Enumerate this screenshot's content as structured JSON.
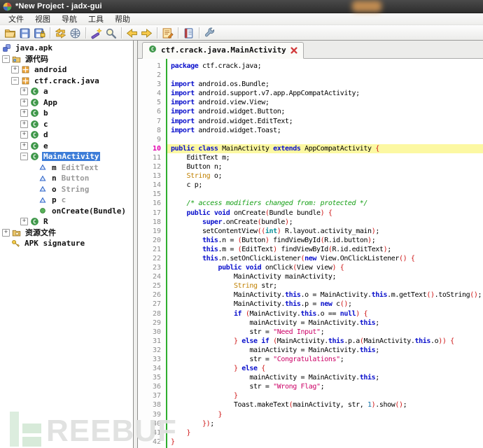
{
  "window": {
    "title": "*New Project - jadx-gui",
    "app_icon": "jadx-logo-icon"
  },
  "menubar": {
    "items": [
      {
        "id": "file",
        "label": "文件"
      },
      {
        "id": "view",
        "label": "视图"
      },
      {
        "id": "navigation",
        "label": "导航"
      },
      {
        "id": "tools",
        "label": "工具"
      },
      {
        "id": "help",
        "label": "帮助"
      }
    ]
  },
  "toolbar": {
    "buttons": [
      {
        "icon": "open-file-icon"
      },
      {
        "icon": "save-all-icon"
      },
      {
        "icon": "save-project-icon"
      },
      {
        "icon": "separator"
      },
      {
        "icon": "reload-icon"
      },
      {
        "icon": "deobfuscation-icon"
      },
      {
        "icon": "separator"
      },
      {
        "icon": "magic-wand-icon"
      },
      {
        "icon": "search-icon"
      },
      {
        "icon": "separator"
      },
      {
        "icon": "back-icon"
      },
      {
        "icon": "forward-icon"
      },
      {
        "icon": "separator"
      },
      {
        "icon": "log-viewer-icon"
      },
      {
        "icon": "separator"
      },
      {
        "icon": "report-icon"
      },
      {
        "icon": "separator"
      },
      {
        "icon": "preferences-icon"
      }
    ]
  },
  "sidebar": {
    "items": [
      {
        "id": "java-apk",
        "label": "java.apk",
        "icon": "apk",
        "level": 0,
        "expander": null
      },
      {
        "id": "source-code",
        "label": "源代码",
        "icon": "folder-src",
        "level": 0,
        "expander": "minus"
      },
      {
        "id": "android",
        "label": "android",
        "icon": "package",
        "level": 1,
        "expander": "plus"
      },
      {
        "id": "ctf-crack-java",
        "label": "ctf.crack.java",
        "icon": "package",
        "level": 1,
        "expander": "minus"
      },
      {
        "id": "class-a",
        "label": "a",
        "icon": "class",
        "level": 2,
        "expander": "plus"
      },
      {
        "id": "class-app",
        "label": "App",
        "icon": "class",
        "level": 2,
        "expander": "plus"
      },
      {
        "id": "class-b",
        "label": "b",
        "icon": "class",
        "level": 2,
        "expander": "plus"
      },
      {
        "id": "class-c",
        "label": "c",
        "icon": "class",
        "level": 2,
        "expander": "plus"
      },
      {
        "id": "class-d",
        "label": "d",
        "icon": "class",
        "level": 2,
        "expander": "plus"
      },
      {
        "id": "class-e",
        "label": "e",
        "icon": "class",
        "level": 2,
        "expander": "plus"
      },
      {
        "id": "class-mainactivity",
        "label": "MainActivity",
        "icon": "class",
        "level": 2,
        "expander": "minus",
        "selected": true
      },
      {
        "id": "field-m",
        "label": "m",
        "type": "EditText",
        "icon": "field",
        "level": 3,
        "expander": null
      },
      {
        "id": "field-n",
        "label": "n",
        "type": "Button",
        "icon": "field",
        "level": 3,
        "expander": null
      },
      {
        "id": "field-o",
        "label": "o",
        "type": "String",
        "icon": "field",
        "level": 3,
        "expander": null
      },
      {
        "id": "field-p",
        "label": "p",
        "type": "c",
        "icon": "field",
        "level": 3,
        "expander": null
      },
      {
        "id": "method-oncreate",
        "label": "onCreate(Bundle)",
        "icon": "method",
        "level": 3,
        "expander": null
      },
      {
        "id": "class-r",
        "label": "R",
        "icon": "class",
        "level": 2,
        "expander": "plus"
      },
      {
        "id": "resources",
        "label": "资源文件",
        "icon": "folder-res",
        "level": 0,
        "expander": "plus"
      },
      {
        "id": "apk-signature",
        "label": "APK signature",
        "icon": "key",
        "level": 0,
        "expander": null
      }
    ]
  },
  "editor": {
    "tab": {
      "label": "ctf.crack.java.MainActivity",
      "icon": "class",
      "close": "close-icon"
    },
    "active_line": 10,
    "lines": [
      [
        [
          "k",
          "package"
        ],
        [
          "d",
          " ctf.crack.java;"
        ]
      ],
      [],
      [
        [
          "k",
          "import"
        ],
        [
          "d",
          " android.os.Bundle;"
        ]
      ],
      [
        [
          "k",
          "import"
        ],
        [
          "d",
          " android.support.v7.app.AppCompatActivity;"
        ]
      ],
      [
        [
          "k",
          "import"
        ],
        [
          "d",
          " android.view.View;"
        ]
      ],
      [
        [
          "k",
          "import"
        ],
        [
          "d",
          " android.widget.Button;"
        ]
      ],
      [
        [
          "k",
          "import"
        ],
        [
          "d",
          " android.widget.EditText;"
        ]
      ],
      [
        [
          "k",
          "import"
        ],
        [
          "d",
          " android.widget.Toast;"
        ]
      ],
      [],
      [
        [
          "k",
          "public"
        ],
        [
          "d",
          " "
        ],
        [
          "k",
          "class"
        ],
        [
          "d",
          " MainActivity "
        ],
        [
          "k",
          "extends"
        ],
        [
          "d",
          " AppCompatActivity "
        ],
        [
          "p",
          "{"
        ]
      ],
      [
        [
          "d",
          "    EditText m;"
        ]
      ],
      [
        [
          "d",
          "    Button n;"
        ]
      ],
      [
        [
          "d",
          "    "
        ],
        [
          "f",
          "String"
        ],
        [
          "d",
          " o;"
        ]
      ],
      [
        [
          "d",
          "    c p;"
        ]
      ],
      [],
      [
        [
          "c",
          "    /* access modifiers changed from: protected */"
        ]
      ],
      [
        [
          "d",
          "    "
        ],
        [
          "k",
          "public"
        ],
        [
          "d",
          " "
        ],
        [
          "k",
          "void"
        ],
        [
          "d",
          " onCreate"
        ],
        [
          "p",
          "("
        ],
        [
          "d",
          "Bundle bundle"
        ],
        [
          "p",
          ")"
        ],
        [
          "d",
          " "
        ],
        [
          "p",
          "{"
        ]
      ],
      [
        [
          "d",
          "        "
        ],
        [
          "k",
          "super"
        ],
        [
          "d",
          ".onCreate"
        ],
        [
          "p",
          "("
        ],
        [
          "d",
          "bundle"
        ],
        [
          "p",
          ")"
        ],
        [
          "d",
          ";"
        ]
      ],
      [
        [
          "d",
          "        setContentView"
        ],
        [
          "p",
          "(("
        ],
        [
          "t",
          "int"
        ],
        [
          "p",
          ")"
        ],
        [
          "d",
          " R.layout.activity_main"
        ],
        [
          "p",
          ")"
        ],
        [
          "d",
          ";"
        ]
      ],
      [
        [
          "d",
          "        "
        ],
        [
          "k",
          "this"
        ],
        [
          "d",
          ".n = "
        ],
        [
          "p",
          "("
        ],
        [
          "d",
          "Button"
        ],
        [
          "p",
          ")"
        ],
        [
          "d",
          " findViewById"
        ],
        [
          "p",
          "("
        ],
        [
          "d",
          "R.id.button"
        ],
        [
          "p",
          ")"
        ],
        [
          "d",
          ";"
        ]
      ],
      [
        [
          "d",
          "        "
        ],
        [
          "k",
          "this"
        ],
        [
          "d",
          ".m = "
        ],
        [
          "p",
          "("
        ],
        [
          "d",
          "EditText"
        ],
        [
          "p",
          ")"
        ],
        [
          "d",
          " findViewById"
        ],
        [
          "p",
          "("
        ],
        [
          "d",
          "R.id.editText"
        ],
        [
          "p",
          ")"
        ],
        [
          "d",
          ";"
        ]
      ],
      [
        [
          "d",
          "        "
        ],
        [
          "k",
          "this"
        ],
        [
          "d",
          ".n.setOnClickListener"
        ],
        [
          "p",
          "("
        ],
        [
          "k",
          "new"
        ],
        [
          "d",
          " View.OnClickListener"
        ],
        [
          "p",
          "()"
        ],
        [
          "d",
          " "
        ],
        [
          "p",
          "{"
        ]
      ],
      [
        [
          "d",
          "            "
        ],
        [
          "k",
          "public"
        ],
        [
          "d",
          " "
        ],
        [
          "k",
          "void"
        ],
        [
          "d",
          " onClick"
        ],
        [
          "p",
          "("
        ],
        [
          "d",
          "View view"
        ],
        [
          "p",
          ")"
        ],
        [
          "d",
          " "
        ],
        [
          "p",
          "{"
        ]
      ],
      [
        [
          "d",
          "                MainActivity mainActivity;"
        ]
      ],
      [
        [
          "d",
          "                "
        ],
        [
          "f",
          "String"
        ],
        [
          "d",
          " str;"
        ]
      ],
      [
        [
          "d",
          "                MainActivity."
        ],
        [
          "k",
          "this"
        ],
        [
          "d",
          ".o = MainActivity."
        ],
        [
          "k",
          "this"
        ],
        [
          "d",
          ".m.getText"
        ],
        [
          "p",
          "()"
        ],
        [
          "d",
          ".toString"
        ],
        [
          "p",
          "()"
        ],
        [
          "d",
          ";"
        ]
      ],
      [
        [
          "d",
          "                MainActivity."
        ],
        [
          "k",
          "this"
        ],
        [
          "d",
          ".p = "
        ],
        [
          "k",
          "new"
        ],
        [
          "d",
          " c"
        ],
        [
          "p",
          "()"
        ],
        [
          "d",
          ";"
        ]
      ],
      [
        [
          "d",
          "                "
        ],
        [
          "k",
          "if"
        ],
        [
          "d",
          " "
        ],
        [
          "p",
          "("
        ],
        [
          "d",
          "MainActivity."
        ],
        [
          "k",
          "this"
        ],
        [
          "d",
          ".o == "
        ],
        [
          "k",
          "null"
        ],
        [
          "p",
          ")"
        ],
        [
          "d",
          " "
        ],
        [
          "p",
          "{"
        ]
      ],
      [
        [
          "d",
          "                    mainActivity = MainActivity."
        ],
        [
          "k",
          "this"
        ],
        [
          "d",
          ";"
        ]
      ],
      [
        [
          "d",
          "                    str = "
        ],
        [
          "s",
          "\"Need Input\""
        ],
        [
          "d",
          ";"
        ]
      ],
      [
        [
          "d",
          "                "
        ],
        [
          "p",
          "}"
        ],
        [
          "d",
          " "
        ],
        [
          "k",
          "else"
        ],
        [
          "d",
          " "
        ],
        [
          "k",
          "if"
        ],
        [
          "d",
          " "
        ],
        [
          "p",
          "("
        ],
        [
          "d",
          "MainActivity."
        ],
        [
          "k",
          "this"
        ],
        [
          "d",
          ".p.a"
        ],
        [
          "p",
          "("
        ],
        [
          "d",
          "MainActivity."
        ],
        [
          "k",
          "this"
        ],
        [
          "d",
          ".o"
        ],
        [
          "p",
          "))"
        ],
        [
          "d",
          " "
        ],
        [
          "p",
          "{"
        ]
      ],
      [
        [
          "d",
          "                    mainActivity = MainActivity."
        ],
        [
          "k",
          "this"
        ],
        [
          "d",
          ";"
        ]
      ],
      [
        [
          "d",
          "                    str = "
        ],
        [
          "s",
          "\"Congratulations\""
        ],
        [
          "d",
          ";"
        ]
      ],
      [
        [
          "d",
          "                "
        ],
        [
          "p",
          "}"
        ],
        [
          "d",
          " "
        ],
        [
          "k",
          "else"
        ],
        [
          "d",
          " "
        ],
        [
          "p",
          "{"
        ]
      ],
      [
        [
          "d",
          "                    mainActivity = MainActivity."
        ],
        [
          "k",
          "this"
        ],
        [
          "d",
          ";"
        ]
      ],
      [
        [
          "d",
          "                    str = "
        ],
        [
          "s",
          "\"Wrong Flag\""
        ],
        [
          "d",
          ";"
        ]
      ],
      [
        [
          "d",
          "                "
        ],
        [
          "p",
          "}"
        ]
      ],
      [
        [
          "d",
          "                Toast.makeText"
        ],
        [
          "p",
          "("
        ],
        [
          "d",
          "mainActivity, str, "
        ],
        [
          "n",
          "1"
        ],
        [
          "p",
          ")"
        ],
        [
          "d",
          ".show"
        ],
        [
          "p",
          "()"
        ],
        [
          "d",
          ";"
        ]
      ],
      [
        [
          "d",
          "            "
        ],
        [
          "p",
          "}"
        ]
      ],
      [
        [
          "d",
          "        "
        ],
        [
          "p",
          "})"
        ],
        [
          "d",
          ";"
        ]
      ],
      [
        [
          "d",
          "    "
        ],
        [
          "p",
          "}"
        ]
      ],
      [
        [
          "p",
          "}"
        ]
      ]
    ]
  },
  "watermark": {
    "text": "REEBUF"
  },
  "colors": {
    "selection": "#3d7dd8",
    "line_highlight": "#fcf8a2",
    "keyword": "#0a10cc",
    "string": "#cc0066",
    "comment": "#17a017",
    "separator_token": "#ce1414",
    "gutter_border": "#2fae2f",
    "active_line_number": "#e300ae"
  }
}
